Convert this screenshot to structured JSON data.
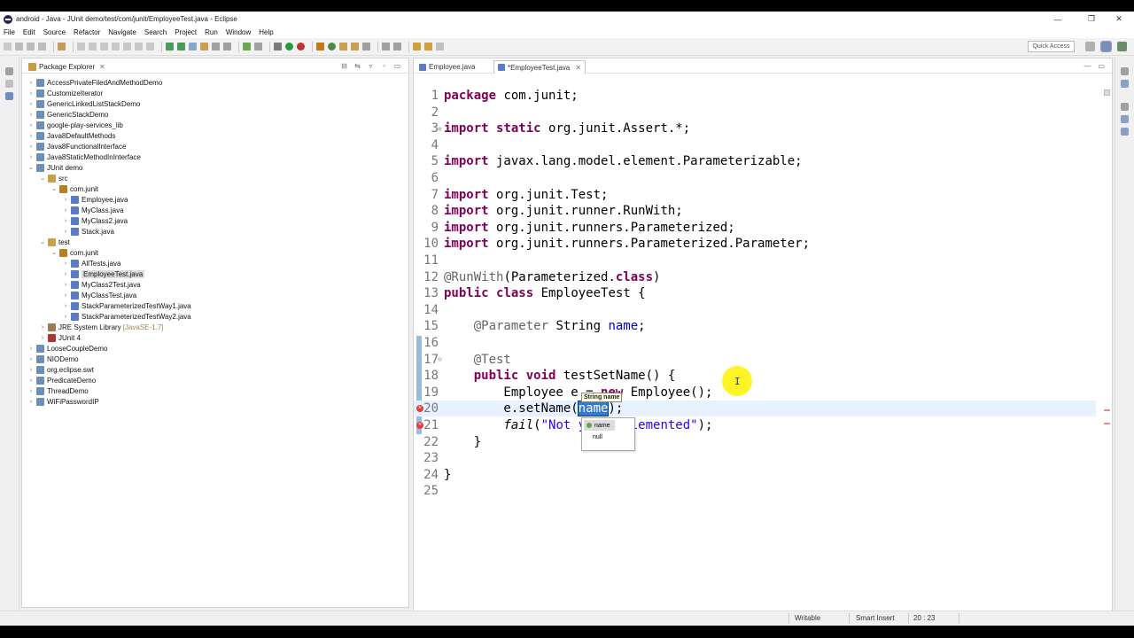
{
  "window": {
    "title": "android - Java - JUnit demo/test/com/junit/EmployeeTest.java - Eclipse",
    "controls": [
      "—",
      "❐",
      "✕"
    ]
  },
  "menu": [
    "File",
    "Edit",
    "Source",
    "Refactor",
    "Navigate",
    "Search",
    "Project",
    "Run",
    "Window",
    "Help"
  ],
  "toolbar": {
    "quick_access_label": "Quick Access"
  },
  "package_explorer": {
    "tab_label": "Package Explorer",
    "tab_close": "✕",
    "tools": [
      "⊟",
      "⇆",
      "▿",
      "▫",
      "▭"
    ],
    "items": [
      {
        "label": "AccessPrivateFiledAndMethodDemo",
        "depth": 0,
        "arrow": "›",
        "icon": "project"
      },
      {
        "label": "CustomizeIterator",
        "depth": 0,
        "arrow": "›",
        "icon": "project"
      },
      {
        "label": "GenericLinkedListStackDemo",
        "depth": 0,
        "arrow": "›",
        "icon": "project"
      },
      {
        "label": "GenericStackDemo",
        "depth": 0,
        "arrow": "›",
        "icon": "project"
      },
      {
        "label": "google-play-services_lib",
        "depth": 0,
        "arrow": "›",
        "icon": "project"
      },
      {
        "label": "Java8DefaultMethods",
        "depth": 0,
        "arrow": "›",
        "icon": "project"
      },
      {
        "label": "Java8FunctionalInterface",
        "depth": 0,
        "arrow": "›",
        "icon": "project"
      },
      {
        "label": "Java8StaticMethodInInterface",
        "depth": 0,
        "arrow": "›",
        "icon": "project"
      },
      {
        "label": "JUnit demo",
        "depth": 0,
        "arrow": "⌄",
        "icon": "project"
      },
      {
        "label": "src",
        "depth": 1,
        "arrow": "⌄",
        "icon": "src"
      },
      {
        "label": "com.junit",
        "depth": 2,
        "arrow": "⌄",
        "icon": "package"
      },
      {
        "label": "Employee.java",
        "depth": 3,
        "arrow": "›",
        "icon": "java"
      },
      {
        "label": "MyClass.java",
        "depth": 3,
        "arrow": "›",
        "icon": "java"
      },
      {
        "label": "MyClass2.java",
        "depth": 3,
        "arrow": "›",
        "icon": "java"
      },
      {
        "label": "Stack.java",
        "depth": 3,
        "arrow": "›",
        "icon": "java"
      },
      {
        "label": "test",
        "depth": 1,
        "arrow": "⌄",
        "icon": "src"
      },
      {
        "label": "com.junit",
        "depth": 2,
        "arrow": "⌄",
        "icon": "package"
      },
      {
        "label": "AllTests.java",
        "depth": 3,
        "arrow": "›",
        "icon": "java"
      },
      {
        "label": "EmployeeTest.java",
        "depth": 3,
        "arrow": "›",
        "icon": "java",
        "selected": true
      },
      {
        "label": "MyClass2Test.java",
        "depth": 3,
        "arrow": "›",
        "icon": "java"
      },
      {
        "label": "MyClassTest.java",
        "depth": 3,
        "arrow": "›",
        "icon": "java"
      },
      {
        "label": "StackParameterizedTestWay1.java",
        "depth": 3,
        "arrow": "›",
        "icon": "java"
      },
      {
        "label": "StackParameterizedTestWay2.java",
        "depth": 3,
        "arrow": "›",
        "icon": "java"
      },
      {
        "label": "JRE System Library",
        "note": "[JavaSE-1.7]",
        "depth": 1,
        "arrow": "›",
        "icon": "lib"
      },
      {
        "label": "JUnit 4",
        "depth": 1,
        "arrow": "›",
        "icon": "junit"
      },
      {
        "label": "LooseCoupleDemo",
        "depth": 0,
        "arrow": "›",
        "icon": "project"
      },
      {
        "label": "NIODemo",
        "depth": 0,
        "arrow": "›",
        "icon": "project"
      },
      {
        "label": "org.eclipse.swt",
        "depth": 0,
        "arrow": "›",
        "icon": "project"
      },
      {
        "label": "PredicateDemo",
        "depth": 0,
        "arrow": "›",
        "icon": "project"
      },
      {
        "label": "ThreadDemo",
        "depth": 0,
        "arrow": "›",
        "icon": "project"
      },
      {
        "label": "WiFiPasswordIP",
        "depth": 0,
        "arrow": "›",
        "icon": "project"
      }
    ]
  },
  "editor": {
    "tabs": [
      {
        "label": "Employee.java",
        "active": false
      },
      {
        "label": "*EmployeeTest.java",
        "active": true,
        "close": "✕"
      }
    ],
    "tools": [
      "—",
      "▭"
    ],
    "current_line": 20,
    "lines": [
      {
        "n": "1",
        "segs": [
          {
            "t": "package",
            "c": "kw"
          },
          {
            "t": " com.junit;"
          }
        ]
      },
      {
        "n": "2",
        "segs": []
      },
      {
        "n": "3",
        "fold": "⊕",
        "segs": [
          {
            "t": "import",
            "c": "kw"
          },
          {
            "t": " "
          },
          {
            "t": "static",
            "c": "kw"
          },
          {
            "t": " org.junit.Assert.*;"
          }
        ]
      },
      {
        "n": "4",
        "segs": []
      },
      {
        "n": "5",
        "segs": [
          {
            "t": "import",
            "c": "kw"
          },
          {
            "t": " javax.lang.model.element.Parameterizable;"
          }
        ]
      },
      {
        "n": "6",
        "segs": []
      },
      {
        "n": "7",
        "segs": [
          {
            "t": "import",
            "c": "kw"
          },
          {
            "t": " org.junit.Test;"
          }
        ]
      },
      {
        "n": "8",
        "segs": [
          {
            "t": "import",
            "c": "kw"
          },
          {
            "t": " org.junit.runner.RunWith;"
          }
        ]
      },
      {
        "n": "9",
        "segs": [
          {
            "t": "import",
            "c": "kw"
          },
          {
            "t": " org.junit.runners.Parameterized;"
          }
        ]
      },
      {
        "n": "10",
        "segs": [
          {
            "t": "import",
            "c": "kw"
          },
          {
            "t": " org.junit.runners.Parameterized.Parameter;"
          }
        ]
      },
      {
        "n": "11",
        "segs": []
      },
      {
        "n": "12",
        "segs": [
          {
            "t": "@RunWith",
            "c": "ann"
          },
          {
            "t": "(Parameterized."
          },
          {
            "t": "class",
            "c": "kw"
          },
          {
            "t": ")"
          }
        ]
      },
      {
        "n": "13",
        "segs": [
          {
            "t": "public",
            "c": "kw"
          },
          {
            "t": " "
          },
          {
            "t": "class",
            "c": "kw"
          },
          {
            "t": " EmployeeTest {"
          }
        ]
      },
      {
        "n": "14",
        "segs": []
      },
      {
        "n": "15",
        "segs": [
          {
            "t": "    "
          },
          {
            "t": "@Parameter",
            "c": "ann"
          },
          {
            "t": " String "
          },
          {
            "t": "name",
            "c": "fld"
          },
          {
            "t": ";"
          }
        ]
      },
      {
        "n": "16",
        "segs": []
      },
      {
        "n": "17",
        "fold": "⊖",
        "segs": [
          {
            "t": "    "
          },
          {
            "t": "@Test",
            "c": "ann"
          }
        ]
      },
      {
        "n": "18",
        "segs": [
          {
            "t": "    "
          },
          {
            "t": "public",
            "c": "kw"
          },
          {
            "t": " "
          },
          {
            "t": "void",
            "c": "kw"
          },
          {
            "t": " testSetName() {"
          }
        ]
      },
      {
        "n": "19",
        "segs": [
          {
            "t": "        Employee e = "
          },
          {
            "t": "new",
            "c": "kw"
          },
          {
            "t": " Employee();"
          }
        ]
      },
      {
        "n": "20",
        "error": true,
        "segs": [
          {
            "t": "        e.setName("
          },
          {
            "t": "name",
            "c": "sel"
          },
          {
            "t": ");"
          }
        ]
      },
      {
        "n": "21",
        "error": true,
        "segs": [
          {
            "t": "        "
          },
          {
            "t": "fail",
            "c": "it"
          },
          {
            "t": "("
          },
          {
            "t": "\"Not yet implemented\"",
            "c": "str"
          },
          {
            "t": ");"
          }
        ]
      },
      {
        "n": "22",
        "segs": [
          {
            "t": "    }"
          }
        ]
      },
      {
        "n": "23",
        "segs": []
      },
      {
        "n": "24",
        "segs": [
          {
            "t": "}"
          }
        ]
      },
      {
        "n": "25",
        "segs": []
      }
    ],
    "hint_tooltip": "String name",
    "proposals": [
      "name",
      "null"
    ]
  },
  "status": {
    "writable": "Writable",
    "insert_mode": "Smart Insert",
    "position": "20 : 23"
  }
}
